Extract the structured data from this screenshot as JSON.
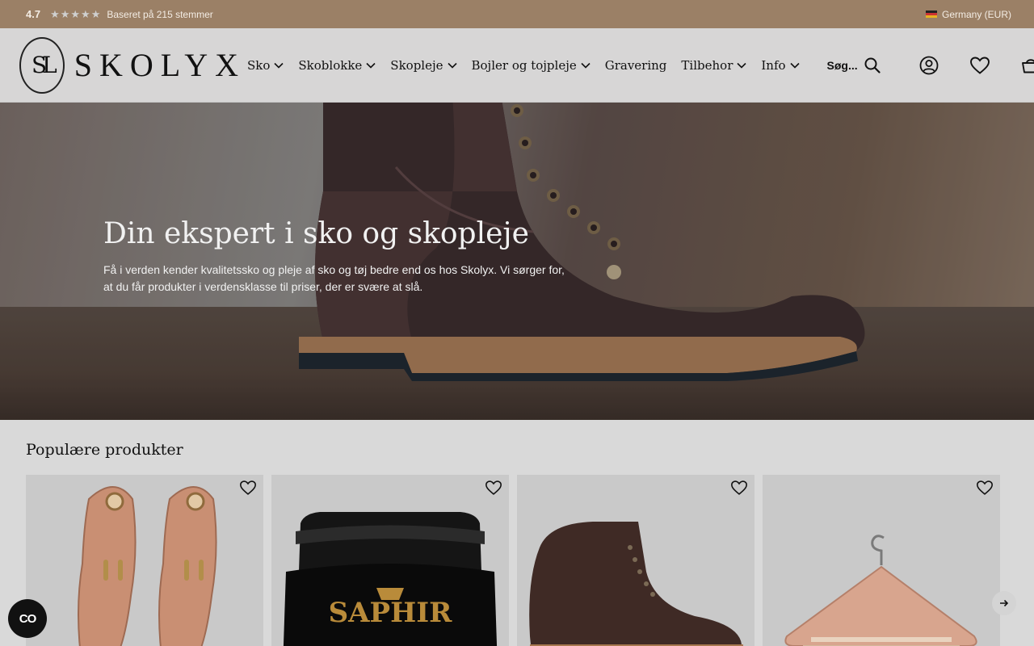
{
  "topbar": {
    "rating": "4.7",
    "stars": 4.5,
    "based_on": "Baseret på 215 stemmer",
    "region": "Germany (EUR)"
  },
  "header": {
    "logo_text": "SKOLYX",
    "logo_mark": "SL",
    "nav": [
      {
        "label": "Sko",
        "dropdown": true
      },
      {
        "label": "Skoblokke",
        "dropdown": true
      },
      {
        "label": "Skopleje",
        "dropdown": true
      },
      {
        "label": "Bojler og tojpleje",
        "dropdown": true
      },
      {
        "label": "Gravering",
        "dropdown": false
      },
      {
        "label": "Tilbehor",
        "dropdown": true
      },
      {
        "label": "Info",
        "dropdown": true
      }
    ],
    "search_label": "Søg..."
  },
  "hero": {
    "title": "Din ekspert i sko og skopleje",
    "subtitle": "Få i verden kender kvalitetssko og pleje af sko og tøj bedre end os hos Skolyx. Vi sørger for, at du får produkter i verdensklasse til priser, der er svære at slå."
  },
  "products": {
    "title": "Populære produkter",
    "items": [
      {
        "image": "cedar-shoe-trees"
      },
      {
        "image": "saphir-polish-jar",
        "brand": "SAPHIR"
      },
      {
        "image": "brown-leather-boot"
      },
      {
        "image": "cedar-hanger"
      }
    ]
  },
  "widgets": {
    "accessibility_label": "CO"
  },
  "colors": {
    "topbar": "#9b8066",
    "header": "#d7d6d6",
    "page": "#d9d9d9"
  }
}
